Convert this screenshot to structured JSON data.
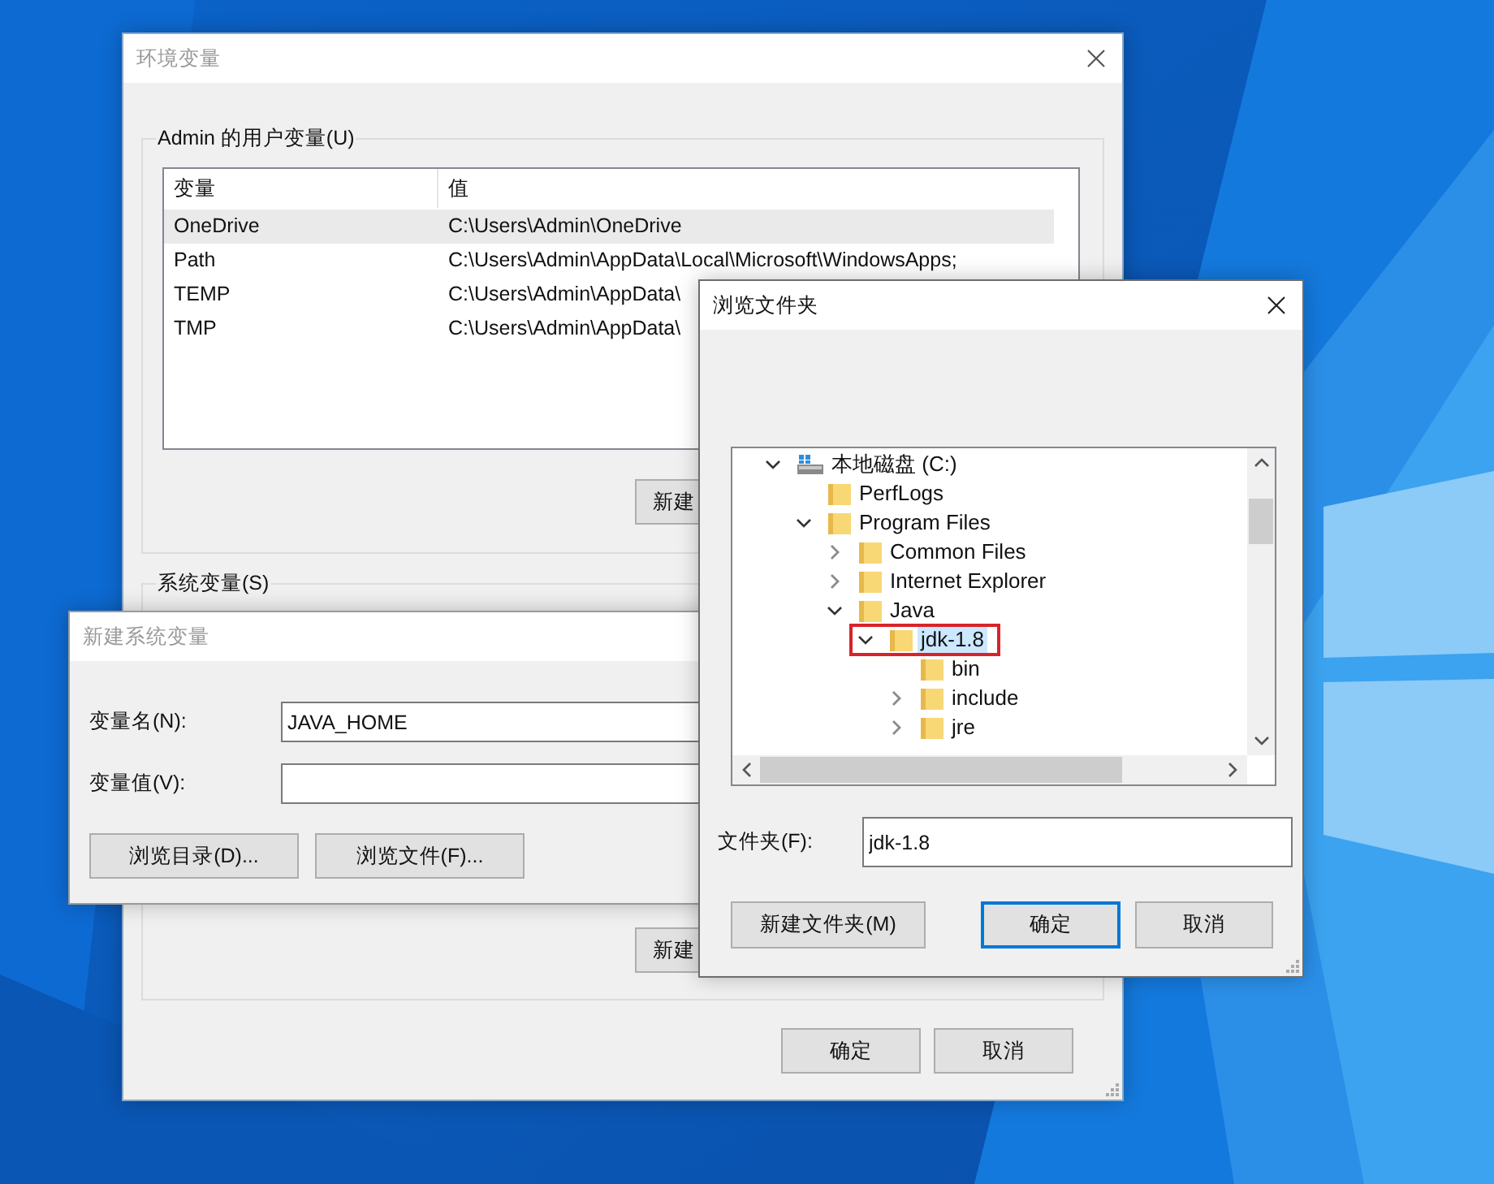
{
  "env_window": {
    "title": "环境变量",
    "active": false,
    "user_group": {
      "label": "Admin 的用户变量(U)",
      "columns": [
        "变量",
        "值"
      ],
      "rows": [
        {
          "name": "OneDrive",
          "value": "C:\\Users\\Admin\\OneDrive",
          "selected": true
        },
        {
          "name": "Path",
          "value": "C:\\Users\\Admin\\AppData\\Local\\Microsoft\\WindowsApps;",
          "selected": false
        },
        {
          "name": "TEMP",
          "value": "C:\\Users\\Admin\\AppData\\",
          "selected": false
        },
        {
          "name": "TMP",
          "value": "C:\\Users\\Admin\\AppData\\",
          "selected": false
        }
      ],
      "button": "新建"
    },
    "system_group": {
      "label": "系统变量(S)",
      "button": "新建"
    },
    "buttons": [
      "确定",
      "取消"
    ]
  },
  "new_var_dialog": {
    "title": "新建系统变量",
    "active": false,
    "fields": [
      {
        "label": "变量名(N):",
        "value": "JAVA_HOME"
      },
      {
        "label": "变量值(V):"
      }
    ],
    "buttons": [
      "浏览目录(D)...",
      "浏览文件(F)..."
    ]
  },
  "browse_dialog": {
    "title": "浏览文件夹",
    "active": true,
    "tree": [
      {
        "label": "本地磁盘 (C:)",
        "kind": "drive",
        "expandable": true,
        "expanded": true,
        "selected": false,
        "highlighted": false,
        "children": [
          {
            "label": "PerfLogs",
            "kind": "folder",
            "expandable": false,
            "selected": false,
            "highlighted": false
          },
          {
            "label": "Program Files",
            "kind": "folder",
            "expandable": true,
            "expanded": true,
            "selected": false,
            "highlighted": false,
            "children": [
              {
                "label": "Common Files",
                "kind": "folder",
                "expandable": true,
                "expanded": false,
                "selected": false,
                "highlighted": false
              },
              {
                "label": "Internet Explorer",
                "kind": "folder",
                "expandable": true,
                "expanded": false,
                "selected": false,
                "highlighted": false
              },
              {
                "label": "Java",
                "kind": "folder",
                "expandable": true,
                "expanded": true,
                "selected": false,
                "highlighted": false,
                "children": [
                  {
                    "label": "jdk-1.8",
                    "kind": "folder",
                    "expandable": true,
                    "expanded": true,
                    "selected": true,
                    "highlighted": true,
                    "children": [
                      {
                        "label": "bin",
                        "kind": "folder",
                        "expandable": false,
                        "selected": false,
                        "highlighted": false
                      },
                      {
                        "label": "include",
                        "kind": "folder",
                        "expandable": true,
                        "expanded": false,
                        "selected": false,
                        "highlighted": false
                      },
                      {
                        "label": "jre",
                        "kind": "folder",
                        "expandable": true,
                        "expanded": false,
                        "selected": false,
                        "highlighted": false
                      }
                    ]
                  }
                ]
              }
            ]
          }
        ]
      }
    ],
    "folder_field": {
      "label": "文件夹(F):",
      "value": "jdk-1.8"
    },
    "buttons": [
      {
        "label": "新建文件夹(M)",
        "default": false
      },
      {
        "label": "确定",
        "default": true
      },
      {
        "label": "取消",
        "default": false
      }
    ]
  }
}
